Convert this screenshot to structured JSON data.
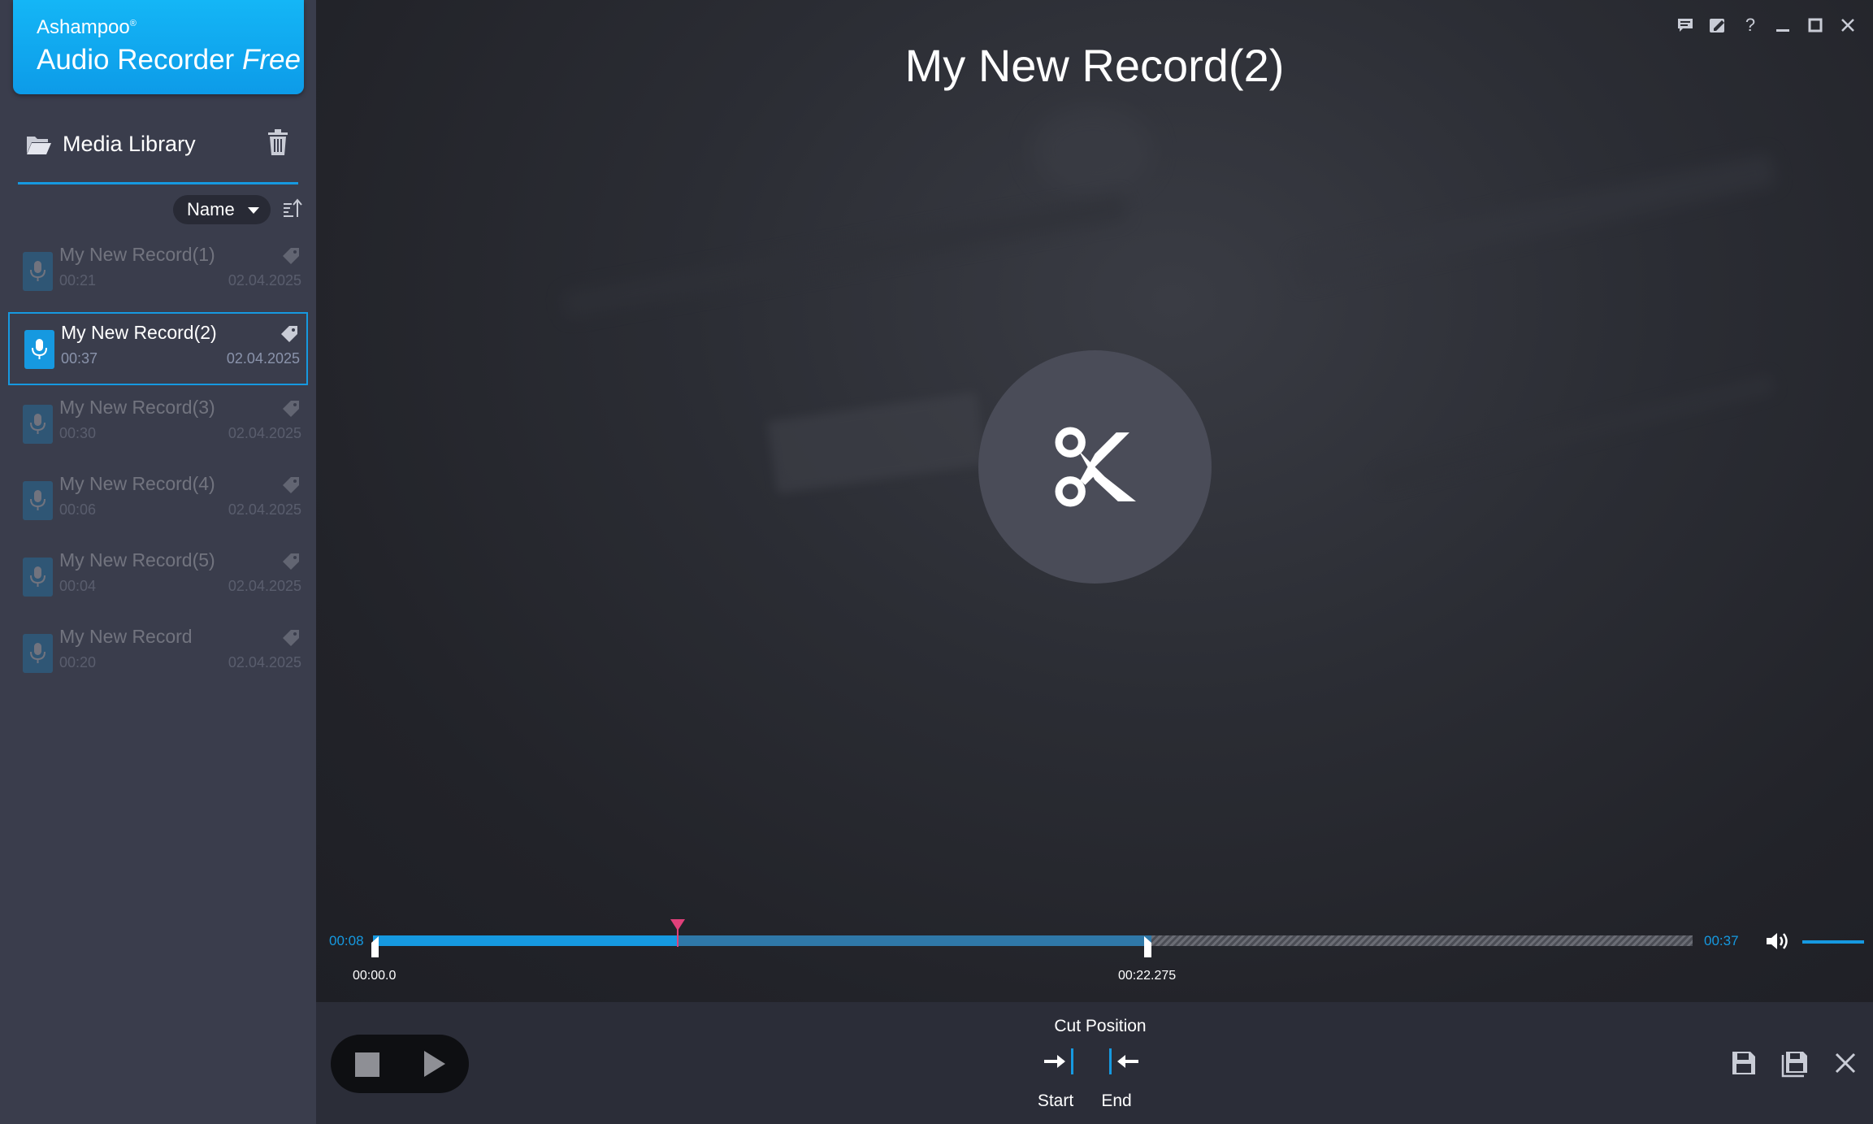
{
  "app": {
    "vendor": "Ashampoo",
    "registered_mark": "®",
    "product": "Audio Recorder",
    "edition": "Free",
    "accent_color": "#1699e0"
  },
  "sidebar": {
    "library_label": "Media Library",
    "sort": {
      "selected": "Name"
    },
    "recordings": [
      {
        "title": "My New Record(1)",
        "duration": "00:21",
        "date": "02.04.2025",
        "selected": false
      },
      {
        "title": "My New Record(2)",
        "duration": "00:37",
        "date": "02.04.2025",
        "selected": true
      },
      {
        "title": "My New Record(3)",
        "duration": "00:30",
        "date": "02.04.2025",
        "selected": false
      },
      {
        "title": "My New Record(4)",
        "duration": "00:06",
        "date": "02.04.2025",
        "selected": false
      },
      {
        "title": "My New Record(5)",
        "duration": "00:04",
        "date": "02.04.2025",
        "selected": false
      },
      {
        "title": "My New Record",
        "duration": "00:20",
        "date": "02.04.2025",
        "selected": false
      }
    ]
  },
  "main": {
    "record_title": "My New Record(2)",
    "icons": {
      "window": [
        "feedback-icon",
        "edit-icon",
        "help-icon",
        "minimize-icon",
        "maximize-icon",
        "close-icon"
      ],
      "center": "scissors-icon"
    }
  },
  "timeline": {
    "current_time": "00:08",
    "total_time": "00:37",
    "cut_start_time": "00:00.0",
    "cut_end_time": "00:22.275",
    "played_fraction": 0.23,
    "cut_range_fraction": 0.59,
    "volume_fraction": 1.0,
    "playhead_color": "#e0407a"
  },
  "bottom": {
    "cut_position_label": "Cut Position",
    "start_label": "Start",
    "end_label": "End"
  }
}
